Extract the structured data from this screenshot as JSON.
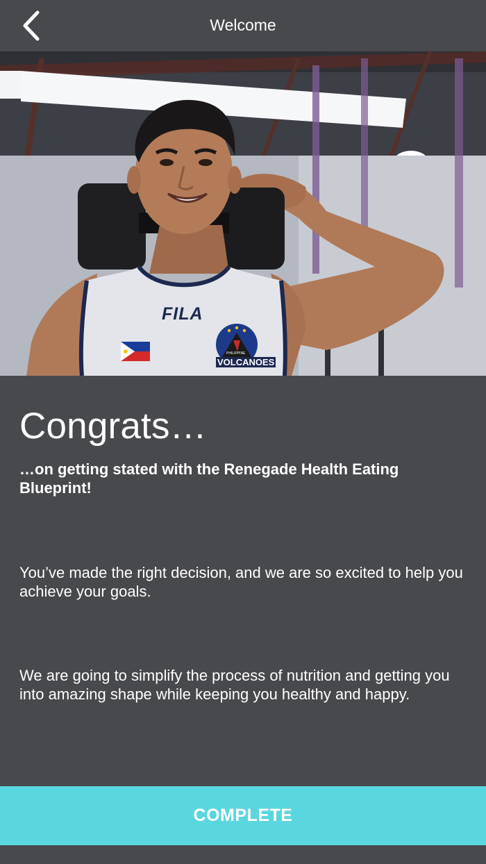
{
  "header": {
    "title": "Welcome",
    "back_icon": "chevron-left-icon"
  },
  "hero": {
    "jersey_brand": "FILA",
    "badge_small_text": "PHILIPPINE",
    "badge_text": "VOLCANOES"
  },
  "main": {
    "heading": "Congrats…",
    "subheading": "…on getting stated with the Renegade Health Eating Blueprint!",
    "paragraphs": [
      "You’ve made the right decision, and we are so excited to help you achieve your goals.",
      "We are going to simplify the process of nutrition and getting you into amazing shape while keeping you healthy and happy."
    ]
  },
  "footer": {
    "complete_label": "COMPLETE"
  },
  "colors": {
    "background": "#48494c",
    "accent": "#5ad6de",
    "text": "#ffffff"
  }
}
